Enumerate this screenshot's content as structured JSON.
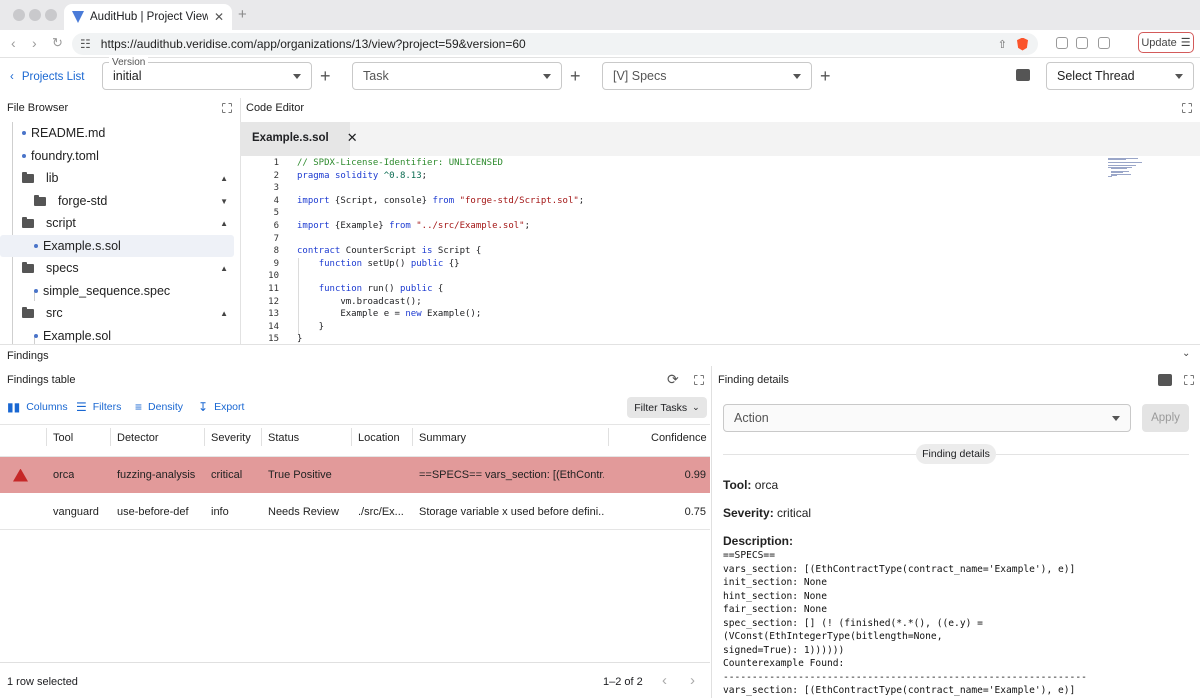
{
  "browser": {
    "tab_title": "AuditHub | Project Viewer",
    "tab_close": "✕",
    "new_tab": "+",
    "url": "https://audithub.veridise.com/app/organizations/13/view?project=59&version=60",
    "update_label": "Update"
  },
  "topbar": {
    "projects_link": "Projects List",
    "version_legend": "Version",
    "version_value": "initial",
    "task_placeholder": "Task",
    "specs_value": "[V] Specs",
    "thread_placeholder": "Select Thread"
  },
  "file_browser": {
    "title": "File Browser",
    "items": [
      {
        "label": "README.md",
        "type": "file"
      },
      {
        "label": "foundry.toml",
        "type": "file"
      },
      {
        "label": "lib",
        "type": "folder",
        "expanded": true
      },
      {
        "label": "forge-std",
        "type": "folder",
        "expanded": false
      },
      {
        "label": "script",
        "type": "folder",
        "expanded": true
      },
      {
        "label": "Example.s.sol",
        "type": "file",
        "selected": true
      },
      {
        "label": "specs",
        "type": "folder",
        "expanded": true
      },
      {
        "label": "simple_sequence.spec",
        "type": "file"
      },
      {
        "label": "src",
        "type": "folder",
        "expanded": true
      },
      {
        "label": "Example.sol",
        "type": "file"
      }
    ]
  },
  "code_editor": {
    "title": "Code Editor",
    "tab_label": "Example.s.sol",
    "lines": [
      {
        "n": "1",
        "text": "// SPDX-License-Identifier: UNLICENSED"
      },
      {
        "n": "2",
        "text": "pragma solidity ^0.8.13;"
      },
      {
        "n": "3",
        "text": ""
      },
      {
        "n": "4",
        "text": "import {Script, console} from \"forge-std/Script.sol\";"
      },
      {
        "n": "5",
        "text": ""
      },
      {
        "n": "6",
        "text": "import {Example} from \"../src/Example.sol\";"
      },
      {
        "n": "7",
        "text": ""
      },
      {
        "n": "8",
        "text": "contract CounterScript is Script {"
      },
      {
        "n": "9",
        "text": "    function setUp() public {}"
      },
      {
        "n": "10",
        "text": ""
      },
      {
        "n": "11",
        "text": "    function run() public {"
      },
      {
        "n": "12",
        "text": "        vm.broadcast();"
      },
      {
        "n": "13",
        "text": "        Example e = new Example();"
      },
      {
        "n": "14",
        "text": "    }"
      },
      {
        "n": "15",
        "text": "}"
      }
    ]
  },
  "findings": {
    "section_title": "Findings",
    "table_title": "Findings table",
    "toolbar": {
      "columns": "Columns",
      "filters": "Filters",
      "density": "Density",
      "export": "Export",
      "filter_tasks": "Filter Tasks"
    },
    "headers": {
      "tool": "Tool",
      "detector": "Detector",
      "severity": "Severity",
      "status": "Status",
      "location": "Location",
      "summary": "Summary",
      "confidence": "Confidence"
    },
    "rows": [
      {
        "tool": "orca",
        "detector": "fuzzing-analysis",
        "severity": "critical",
        "status": "True Positive",
        "location": "",
        "summary": "==SPECS== vars_section: [(EthContr...",
        "confidence": "0.99"
      },
      {
        "tool": "vanguard",
        "detector": "use-before-def",
        "severity": "info",
        "status": "Needs Review",
        "location": "./src/Ex...",
        "summary": "Storage variable x used before defini...",
        "confidence": "0.75"
      }
    ],
    "footer": {
      "selected": "1 row selected",
      "pagination": "1–2 of 2"
    }
  },
  "details": {
    "title": "Finding details",
    "action_placeholder": "Action",
    "apply_label": "Apply",
    "chip": "Finding details",
    "tool_label": "Tool:",
    "tool_value": "orca",
    "severity_label": "Severity:",
    "severity_value": "critical",
    "description_label": "Description:",
    "description": "==SPECS==\nvars_section: [(EthContractType(contract_name='Example'), e)]\ninit_section: None\nhint_section: None\nfair_section: None\nspec_section: [] (! (finished(*.*(), ((e.y) = (VConst(EthIntegerType(bitlength=None,\nsigned=True): 1))))))\nCounterexample Found:\n---------------------------------------------------------------\nvars_section: [(EthContractType(contract_name='Example'), e)]\ninit_section: None"
  }
}
